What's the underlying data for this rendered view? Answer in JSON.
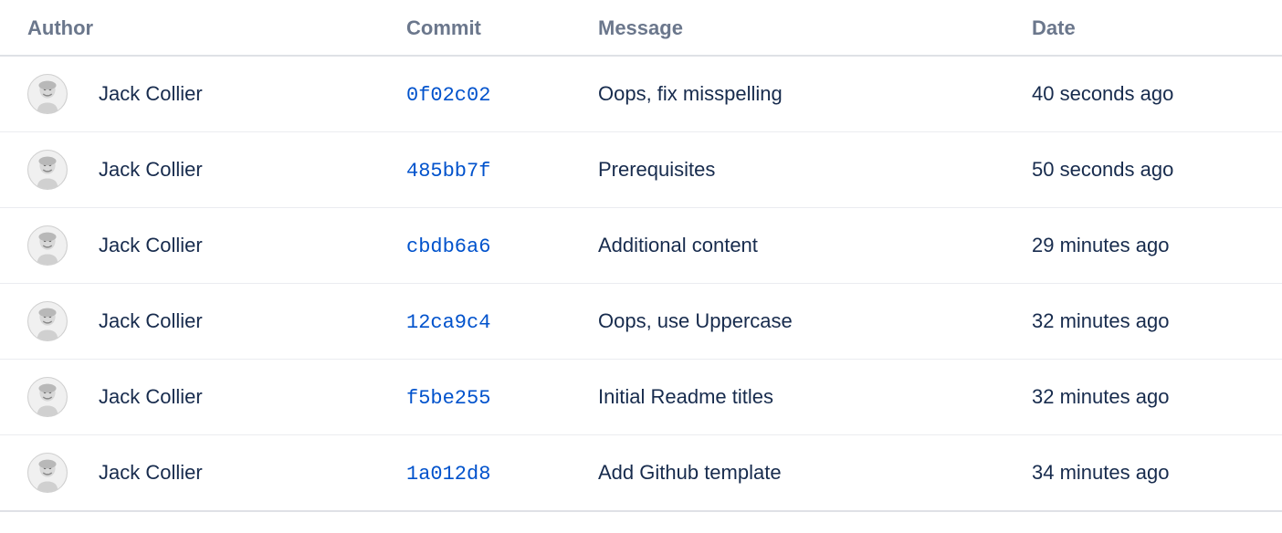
{
  "headers": {
    "author": "Author",
    "commit": "Commit",
    "message": "Message",
    "date": "Date"
  },
  "commits": [
    {
      "author": "Jack Collier",
      "hash": "0f02c02",
      "message": "Oops, fix misspelling",
      "date": "40 seconds ago"
    },
    {
      "author": "Jack Collier",
      "hash": "485bb7f",
      "message": "Prerequisites",
      "date": "50 seconds ago"
    },
    {
      "author": "Jack Collier",
      "hash": "cbdb6a6",
      "message": "Additional content",
      "date": "29 minutes ago"
    },
    {
      "author": "Jack Collier",
      "hash": "12ca9c4",
      "message": "Oops, use Uppercase",
      "date": "32 minutes ago"
    },
    {
      "author": "Jack Collier",
      "hash": "f5be255",
      "message": "Initial Readme titles",
      "date": "32 minutes ago"
    },
    {
      "author": "Jack Collier",
      "hash": "1a012d8",
      "message": "Add Github template",
      "date": "34 minutes ago"
    }
  ]
}
